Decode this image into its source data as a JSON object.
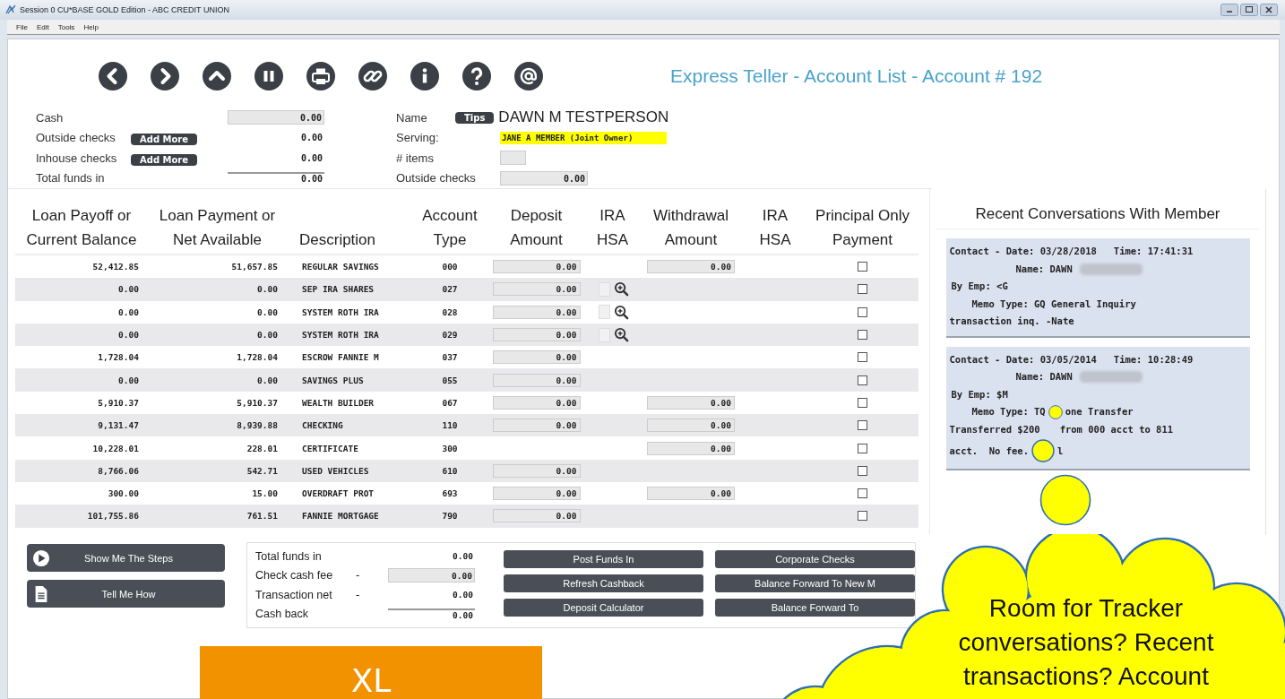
{
  "window": {
    "title": "Session 0 CU*BASE GOLD Edition - ABC CREDIT UNION"
  },
  "menu": [
    "File",
    "Edit",
    "Tools",
    "Help"
  ],
  "toolbar": [
    {
      "kind": "back"
    },
    {
      "kind": "forward"
    },
    {
      "kind": "up"
    },
    {
      "kind": "pause"
    },
    {
      "kind": "print"
    },
    {
      "kind": "link"
    },
    {
      "kind": "info"
    },
    {
      "kind": "help"
    },
    {
      "kind": "email"
    }
  ],
  "heading": "Express Teller - Account List - Account # 192",
  "funds": [
    {
      "label": "Cash",
      "boxed": true,
      "total": false,
      "value": "0.00"
    },
    {
      "label": "Outside checks",
      "button": "Add More",
      "boxed": false,
      "total": false,
      "value": "0.00"
    },
    {
      "label": "Inhouse checks",
      "button": "Add More",
      "boxed": false,
      "total": false,
      "value": "0.00"
    },
    {
      "label": "Total funds in",
      "boxed": false,
      "total": true,
      "value": "0.00"
    }
  ],
  "member": [
    {
      "label": "Name",
      "kind": "name",
      "button": "Tips",
      "value": "DAWN M TESTPERSON"
    },
    {
      "label": "Serving:",
      "kind": "highlight",
      "value": "JANE A MEMBER (Joint Owner)"
    },
    {
      "label": "# items",
      "kind": "box"
    },
    {
      "label": "Outside checks",
      "kind": "box",
      "value": "0.00"
    }
  ],
  "table": {
    "columns": [
      [
        "Loan Payoff or",
        "Current Balance"
      ],
      [
        "Loan Payment or",
        "Net Available"
      ],
      [
        "Description"
      ],
      [
        "Account",
        "Type"
      ],
      [
        "Deposit",
        "Amount"
      ],
      [
        "IRA",
        "HSA"
      ],
      [
        "Withdrawal",
        "Amount"
      ],
      [
        "IRA",
        "HSA"
      ],
      [
        "Principal Only",
        "Payment"
      ]
    ],
    "rows": [
      {
        "balance": "52,412.85",
        "available": "51,657.85",
        "description": "REGULAR SAVINGS",
        "type": "000",
        "deposit": "0.00",
        "ira": false,
        "withdrawal": "0.00",
        "principal_only": false
      },
      {
        "balance": "0.00",
        "available": "0.00",
        "description": "SEP IRA SHARES",
        "type": "027",
        "deposit": "0.00",
        "ira": true,
        "principal_only": false
      },
      {
        "balance": "0.00",
        "available": "0.00",
        "description": "SYSTEM ROTH IRA",
        "type": "028",
        "deposit": "0.00",
        "ira": true,
        "principal_only": false
      },
      {
        "balance": "0.00",
        "available": "0.00",
        "description": "SYSTEM ROTH IRA",
        "type": "029",
        "deposit": "0.00",
        "ira": true,
        "principal_only": false
      },
      {
        "balance": "1,728.04",
        "available": "1,728.04",
        "description": "ESCROW FANNIE M",
        "type": "037",
        "deposit": "0.00",
        "ira": false,
        "principal_only": false
      },
      {
        "balance": "0.00",
        "available": "0.00",
        "description": "SAVINGS PLUS",
        "type": "055",
        "deposit": "0.00",
        "ira": false,
        "principal_only": false
      },
      {
        "balance": "5,910.37",
        "available": "5,910.37",
        "description": "WEALTH BUILDER",
        "type": "067",
        "deposit": "0.00",
        "ira": false,
        "withdrawal": "0.00",
        "principal_only": false
      },
      {
        "balance": "9,131.47",
        "available": "8,939.88",
        "description": "CHECKING",
        "type": "110",
        "deposit": "0.00",
        "ira": false,
        "withdrawal": "0.00",
        "principal_only": false
      },
      {
        "balance": "10,228.01",
        "available": "228.01",
        "description": "CERTIFICATE",
        "type": "300",
        "ira": false,
        "withdrawal": "0.00",
        "principal_only": false
      },
      {
        "balance": "8,766.06",
        "available": "542.71",
        "description": "USED VEHICLES",
        "type": "610",
        "deposit": "0.00",
        "ira": false,
        "principal_only": false
      },
      {
        "balance": "300.00",
        "available": "15.00",
        "description": "OVERDRAFT PROT",
        "type": "693",
        "deposit": "0.00",
        "ira": false,
        "withdrawal": "0.00",
        "principal_only": false
      },
      {
        "balance": "101,755.86",
        "available": "761.51",
        "description": "FANNIE MORTGAGE",
        "type": "790",
        "deposit": "0.00",
        "ira": false,
        "principal_only": false
      }
    ]
  },
  "conversations": {
    "title": "Recent Conversations With Member",
    "entries": [
      {
        "lines": [
          {
            "kind": "contact",
            "segments": [
              "Contact - Date: 03/28/2018   Time: 17:41:31"
            ]
          },
          {
            "kind": "name",
            "segments": [
              "Name: DAWN"
            ],
            "redacted": true
          },
          {
            "kind": "emp",
            "segments": [
              "By Emp: <G"
            ]
          },
          {
            "kind": "memo",
            "segments": [
              "Memo Type: GQ General Inquiry"
            ]
          },
          {
            "kind": "note",
            "segments": [
              "transaction inq. -Nate"
            ]
          }
        ]
      },
      {
        "lines": [
          {
            "kind": "contact",
            "segments": [
              "Contact - Date: 03/05/2014   Time: 10:28:49"
            ]
          },
          {
            "kind": "name",
            "segments": [
              "Name: DAWN"
            ],
            "redacted": true
          },
          {
            "kind": "emp",
            "segments": [
              "By Emp: $M"
            ]
          },
          {
            "kind": "memo",
            "bubble": true,
            "segments": [
              "Memo Type: TQ",
              "one Transfer"
            ]
          },
          {
            "kind": "note",
            "segments": [
              "Transferred $200",
              "from 000 acct to 811"
            ]
          },
          {
            "kind": "note",
            "bubble": true,
            "segments": [
              "acct.  No fee.",
              "l"
            ]
          }
        ]
      }
    ]
  },
  "help_buttons": [
    {
      "kind": "play",
      "label": "Show Me The Steps"
    },
    {
      "kind": "document",
      "label": "Tell Me How"
    }
  ],
  "totals": [
    {
      "label": "Total funds in",
      "boxed": false,
      "total": false,
      "value": "0.00"
    },
    {
      "label": "Check cash fee",
      "sign": "-",
      "boxed": true,
      "total": false,
      "value": "0.00"
    },
    {
      "label": "Transaction net",
      "sign": "-",
      "boxed": false,
      "total": false,
      "value": "0.00"
    },
    {
      "label": "Cash back",
      "boxed": false,
      "total": true,
      "value": "0.00"
    }
  ],
  "actions": [
    "Post Funds In",
    "Corporate Checks",
    "Refresh Cashback",
    "Balance Forward To New M",
    "Deposit Calculator",
    "Balance Forward To"
  ],
  "callout": "Room for Tracker conversations? Recent transactions? Account",
  "size_tag": "XL"
}
